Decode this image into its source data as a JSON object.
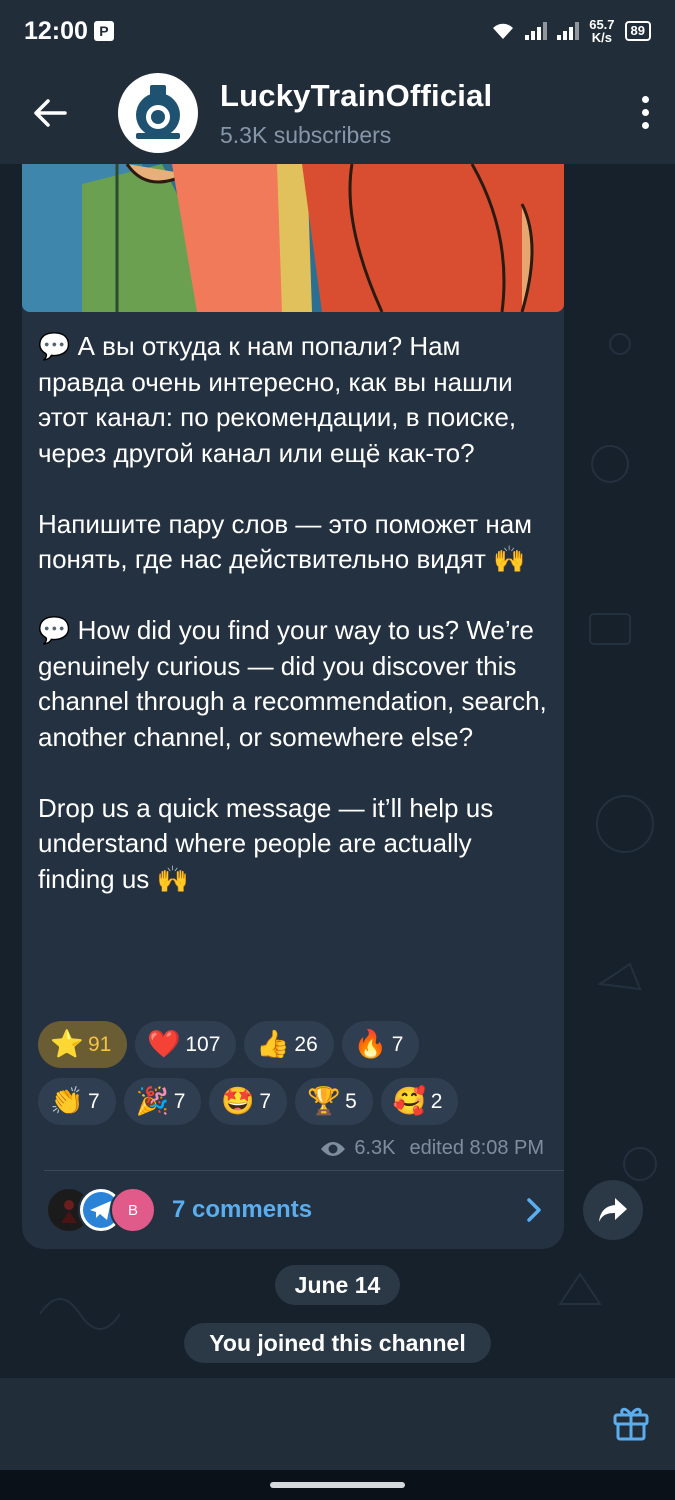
{
  "status_bar": {
    "time": "12:00",
    "net_speed_value": "65.7",
    "net_speed_unit": "K/s",
    "battery": "89"
  },
  "header": {
    "channel_name": "LuckyTrainOfficial",
    "subscribers": "5.3K subscribers"
  },
  "message": {
    "text_ru_1": "💬 А вы откуда к нам попали? Нам правда очень интересно, как вы нашли этот канал: по рекомендации, в поиске, через другой канал или ещё как-то?",
    "text_ru_2": "Напишите пару слов — это поможет нам понять, где нас действительно видят 🙌",
    "text_en_1": "💬 How did you find your way to us? We’re genuinely curious — did you discover this channel through a recommendation, search, another channel, or somewhere else?",
    "text_en_2": "Drop us a quick message — it’ll help us understand where people are actually finding us 🙌",
    "reactions": [
      {
        "emoji": "⭐",
        "count": "91"
      },
      {
        "emoji": "❤️",
        "count": "107"
      },
      {
        "emoji": "👍",
        "count": "26"
      },
      {
        "emoji": "🔥",
        "count": "7"
      },
      {
        "emoji": "👏",
        "count": "7"
      },
      {
        "emoji": "🎉",
        "count": "7"
      },
      {
        "emoji": "🤩",
        "count": "7"
      },
      {
        "emoji": "🏆",
        "count": "5"
      },
      {
        "emoji": "🥰",
        "count": "2"
      }
    ],
    "views": "6.3K",
    "edited": "edited 8:08 PM",
    "comments_label": "7 comments",
    "comment_avatar_letter": "B"
  },
  "service": {
    "date": "June 14",
    "joined": "You joined this channel"
  },
  "colors": {
    "accent": "#5aaef0",
    "bubble": "#243140",
    "header": "#222d3a",
    "star_reaction": "#6b5d33"
  }
}
